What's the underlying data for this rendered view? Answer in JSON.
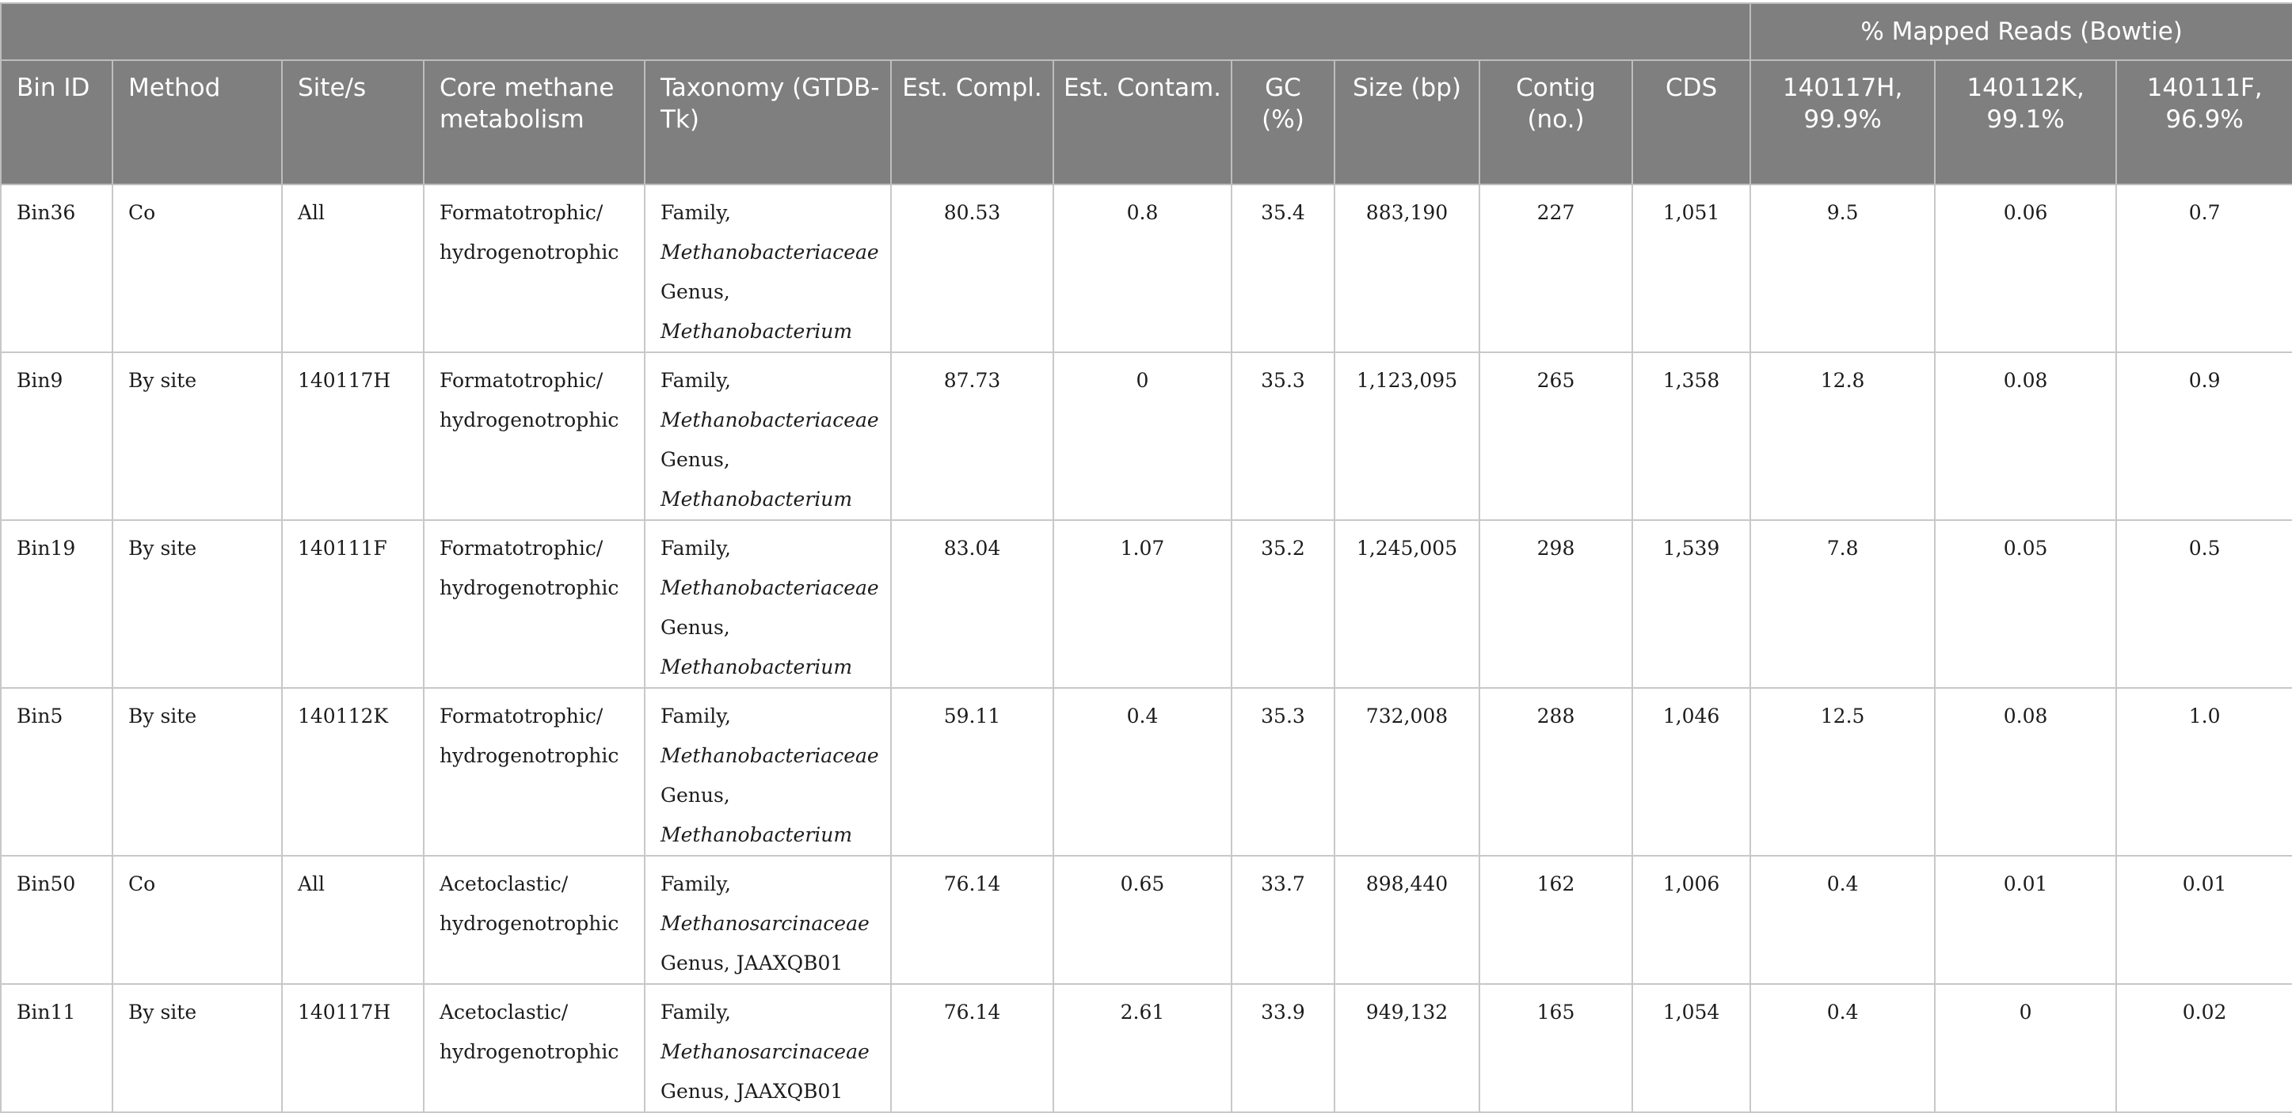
{
  "table": {
    "group_header": "% Mapped Reads (Bowtie)",
    "columns": [
      "Bin ID",
      "Method",
      "Site/s",
      "Core methane metabolism",
      "Taxonomy (GTDB-Tk)",
      "Est. Compl.",
      "Est. Contam.",
      "GC (%)",
      "Size (bp)",
      "Contig (no.)",
      "CDS",
      "140117H, 99.9%",
      "140112K, 99.1%",
      "140111F, 96.9%"
    ],
    "rows": [
      {
        "bin_id": "Bin36",
        "method": "Co",
        "sites": "All",
        "metabolism_1": "Formatotrophic/",
        "metabolism_2": "hydrogenotrophic",
        "tax_family_label": "Family,",
        "tax_family": "Methanobacteriaceae",
        "tax_genus_label": "Genus,",
        "tax_genus": "Methanobacterium",
        "compl": "80.53",
        "contam": "0.8",
        "gc": "35.4",
        "size": "883,190",
        "contig": "227",
        "cds": "1,051",
        "h": "9.5",
        "k": "0.06",
        "f": "0.7"
      },
      {
        "bin_id": "Bin9",
        "method": "By site",
        "sites": "140117H",
        "metabolism_1": "Formatotrophic/",
        "metabolism_2": "hydrogenotrophic",
        "tax_family_label": "Family,",
        "tax_family": "Methanobacteriaceae",
        "tax_genus_label": "Genus,",
        "tax_genus": "Methanobacterium",
        "compl": "87.73",
        "contam": "0",
        "gc": "35.3",
        "size": "1,123,095",
        "contig": "265",
        "cds": "1,358",
        "h": "12.8",
        "k": "0.08",
        "f": "0.9"
      },
      {
        "bin_id": "Bin19",
        "method": "By site",
        "sites": "140111F",
        "metabolism_1": "Formatotrophic/",
        "metabolism_2": "hydrogenotrophic",
        "tax_family_label": "Family,",
        "tax_family": "Methanobacteriaceae",
        "tax_genus_label": "Genus,",
        "tax_genus": "Methanobacterium",
        "compl": "83.04",
        "contam": "1.07",
        "gc": "35.2",
        "size": "1,245,005",
        "contig": "298",
        "cds": "1,539",
        "h": "7.8",
        "k": "0.05",
        "f": "0.5"
      },
      {
        "bin_id": "Bin5",
        "method": "By site",
        "sites": "140112K",
        "metabolism_1": "Formatotrophic/",
        "metabolism_2": "hydrogenotrophic",
        "tax_family_label": "Family,",
        "tax_family": "Methanobacteriaceae",
        "tax_genus_label": "Genus,",
        "tax_genus": "Methanobacterium",
        "compl": "59.11",
        "contam": "0.4",
        "gc": "35.3",
        "size": "732,008",
        "contig": "288",
        "cds": "1,046",
        "h": "12.5",
        "k": "0.08",
        "f": "1.0"
      },
      {
        "bin_id": "Bin50",
        "method": "Co",
        "sites": "All",
        "metabolism_1": "Acetoclastic/",
        "metabolism_2": "hydrogenotrophic",
        "tax_family_label": "Family,",
        "tax_family": "Methanosarcinaceae",
        "tax_genus_line": "Genus, JAAXQB01",
        "compl": "76.14",
        "contam": "0.65",
        "gc": "33.7",
        "size": "898,440",
        "contig": "162",
        "cds": "1,006",
        "h": "0.4",
        "k": "0.01",
        "f": "0.01"
      },
      {
        "bin_id": "Bin11",
        "method": "By site",
        "sites": "140117H",
        "metabolism_1": "Acetoclastic/",
        "metabolism_2": "hydrogenotrophic",
        "tax_family_label": "Family,",
        "tax_family": "Methanosarcinaceae",
        "tax_genus_line": "Genus, JAAXQB01",
        "compl": "76.14",
        "contam": "2.61",
        "gc": "33.9",
        "size": "949,132",
        "contig": "165",
        "cds": "1,054",
        "h": "0.4",
        "k": "0",
        "f": "0.02"
      }
    ]
  }
}
